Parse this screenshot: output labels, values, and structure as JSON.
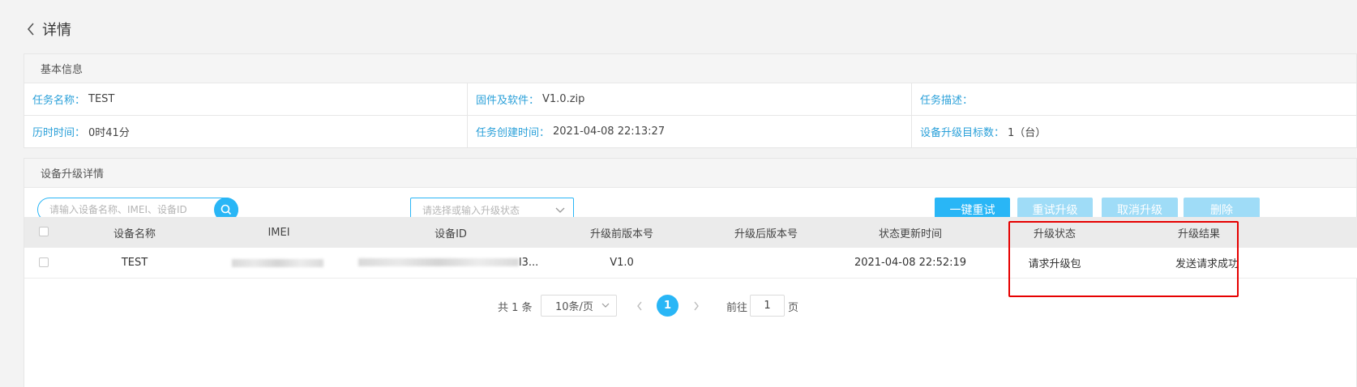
{
  "header": {
    "title": "详情"
  },
  "basic_info": {
    "section_title": "基本信息",
    "fields": [
      {
        "label": "任务名称：",
        "value": "TEST"
      },
      {
        "label": "固件及软件：",
        "value": "V1.0.zip"
      },
      {
        "label": "任务描述：",
        "value": ""
      },
      {
        "label": "历时时间：",
        "value": "0时41分"
      },
      {
        "label": "任务创建时间：",
        "value": "2021-04-08 22:13:27"
      },
      {
        "label": "设备升级目标数：",
        "value": "1（台）"
      }
    ]
  },
  "upgrade_detail": {
    "section_title": "设备升级详情",
    "search": {
      "placeholder": "请输入设备名称、IMEI、设备ID"
    },
    "status_select": {
      "placeholder": "请选择或输入升级状态"
    },
    "buttons": {
      "retry_all": "一键重试",
      "retry_upgrade": "重试升级",
      "cancel_upgrade": "取消升级",
      "delete": "删除"
    },
    "columns": [
      "设备名称",
      "IMEI",
      "设备ID",
      "升级前版本号",
      "升级后版本号",
      "状态更新时间",
      "升级状态",
      "升级结果"
    ],
    "rows": [
      {
        "device_name": "TEST",
        "imei": "",
        "device_id_tail": "l3...",
        "version_before": "V1.0",
        "version_after": "",
        "updated_at": "2021-04-08 22:52:19",
        "status": "请求升级包",
        "result": "发送请求成功"
      }
    ]
  },
  "pagination": {
    "total": "共 1 条",
    "page_size": "10条/页",
    "current_page": "1",
    "goto_label": "前往",
    "goto_value": "1",
    "page_suffix": "页"
  },
  "colors": {
    "accent": "#29b6f6",
    "label_blue": "#2aa0d9",
    "highlight_red": "#e60000",
    "disabled": "#9fdcf7"
  },
  "icons": [
    "chevron-left-icon",
    "search-icon",
    "chevron-down-icon"
  ]
}
